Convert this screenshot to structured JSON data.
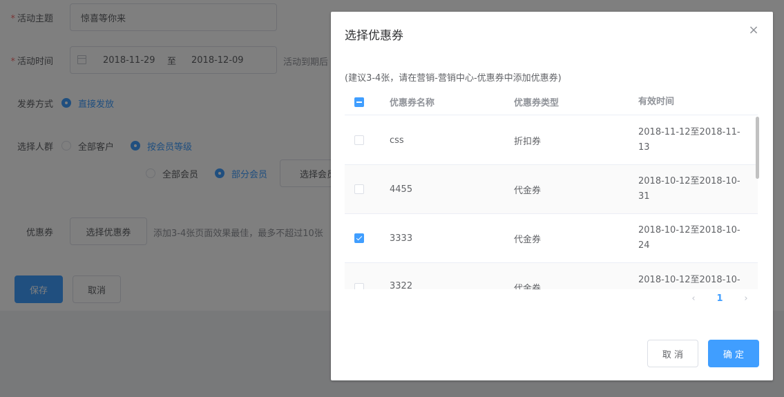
{
  "form": {
    "theme_label": "活动主题",
    "theme_value": "惊喜等你来",
    "time_label": "活动时间",
    "date_start": "2018-11-29",
    "date_sep": "至",
    "date_end": "2018-12-09",
    "time_hint": "活动到期后",
    "issue_label": "发券方式",
    "issue_option": "直接发放",
    "crowd_label": "选择人群",
    "crowd_all": "全部客户",
    "crowd_level": "按会员等级",
    "member_all": "全部会员",
    "member_part": "部分会员",
    "member_select_btn": "选择会员",
    "coupon_label": "优惠券",
    "coupon_btn": "选择优惠券",
    "coupon_hint": "添加3-4张页面效果最佳，最多不超过10张",
    "save_btn": "保存",
    "cancel_btn": "取消"
  },
  "dialog": {
    "title": "选择优惠券",
    "close_icon": "close-icon",
    "note": "(建议3-4张，请在营销-营销中心-优惠券中添加优惠券)",
    "columns": [
      "优惠券名称",
      "优惠券类型",
      "有效时间"
    ],
    "rows": [
      {
        "name": "css",
        "type": "折扣券",
        "time": "2018-11-12至2018-11-13",
        "checked": false
      },
      {
        "name": "4455",
        "type": "代金券",
        "time": "2018-10-12至2018-10-31",
        "checked": false
      },
      {
        "name": "3333",
        "type": "代金券",
        "time": "2018-10-12至2018-10-24",
        "checked": true
      },
      {
        "name": "3322",
        "type": "代金券",
        "time": "2018-10-12至2018-10-",
        "checked": false
      }
    ],
    "pager": {
      "prev": "‹",
      "current": "1",
      "next": "›"
    },
    "cancel_btn": "取 消",
    "ok_btn": "确 定"
  },
  "colors": {
    "primary": "#409eff",
    "required": "#f56c6c"
  }
}
